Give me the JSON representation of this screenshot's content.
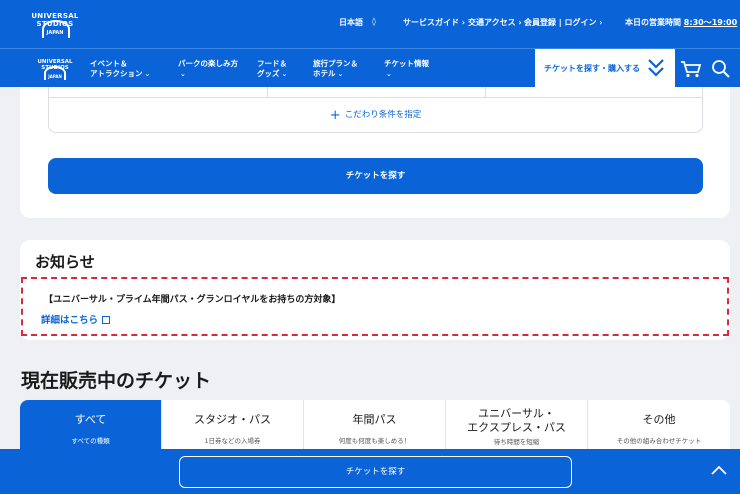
{
  "header": {
    "logo_text": "UNIVERSAL STUDIOS",
    "logo_sub": "JAPAN",
    "language": "日本語",
    "language_arrow": "◊",
    "service_guide": "サービスガイド ›",
    "access": "交通アクセス ›",
    "member": "会員登録 | ログイン ›",
    "hours_label": "本日の営業時間 ",
    "hours_time": "8:30〜19:00"
  },
  "nav": {
    "items": [
      {
        "line1": "イベント＆",
        "line2": "アトラクション"
      },
      {
        "line1": "パークの楽しみ方",
        "line2": ""
      },
      {
        "line1": "フード＆",
        "line2": "グッズ"
      },
      {
        "line1": "旅行プラン＆",
        "line2": "ホテル"
      },
      {
        "line1": "チケット情報",
        "line2": ""
      }
    ],
    "find_buy_label": "チケットを探す・購入する"
  },
  "search": {
    "more_conditions": "こだわり条件を指定",
    "find_button": "チケットを探す"
  },
  "notice": {
    "title": "お知らせ",
    "text": "【ユニバーサル・プライム年間パス・グランロイヤルをお持ちの方対象】",
    "link": "詳細はこちら"
  },
  "tickets": {
    "title": "現在販売中のチケット",
    "tabs": [
      {
        "label": "すべて",
        "sub": "すべての種類",
        "active": true
      },
      {
        "label": "スタジオ・パス",
        "sub": "1日券などの入場券",
        "active": false
      },
      {
        "label": "年間パス",
        "sub": "何度も何度も楽しめる！",
        "active": false
      },
      {
        "label": "ユニバーサル・\nエクスプレス・パス",
        "sub": "待ち時間を短縮",
        "active": false
      },
      {
        "label": "その他",
        "sub": "その他の組み合わせチケット",
        "active": false
      }
    ]
  },
  "bottom_bar": {
    "find_button": "チケットを探す"
  },
  "colors": {
    "brand_blue": "#0a64d8",
    "notice_dash": "#d72a3c",
    "page_bg": "#eef0f3"
  }
}
